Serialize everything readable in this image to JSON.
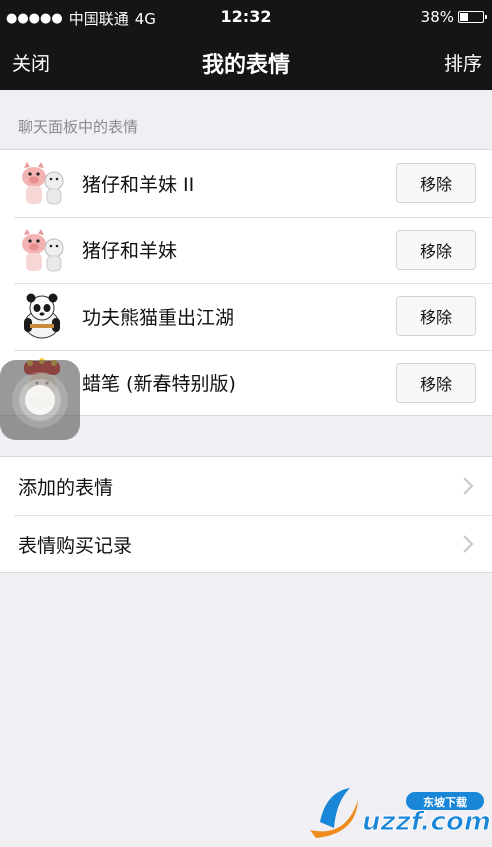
{
  "status_bar": {
    "signal_dots": "●●●●●",
    "carrier": "中国联通",
    "network": "4G",
    "time": "12:32",
    "battery_percent": "38%",
    "battery_level": 0.38
  },
  "nav": {
    "close_label": "关闭",
    "title": "我的表情",
    "sort_label": "排序"
  },
  "section_header": "聊天面板中的表情",
  "sticker_packs": [
    {
      "name": "猪仔和羊妹 II",
      "icon": "pig-and-sheep-sticker-icon",
      "action": "移除"
    },
    {
      "name": "猪仔和羊妹",
      "icon": "pig-and-sheep-sticker-icon",
      "action": "移除"
    },
    {
      "name": "功夫熊猫重出江湖",
      "icon": "kung-fu-panda-sticker-icon",
      "action": "移除"
    },
    {
      "name": "蜡笔 (新春特别版)",
      "icon": "crayon-new-year-sticker-icon",
      "action": "移除"
    }
  ],
  "menu_items": [
    {
      "label": "添加的表情",
      "icon": "chevron-right-icon"
    },
    {
      "label": "表情购买记录",
      "icon": "chevron-right-icon"
    }
  ],
  "watermark": {
    "text": "uzzf.com",
    "badge": "东坡下载"
  },
  "colors": {
    "bar_background": "#151515",
    "page_background": "#efeff4",
    "watermark_blue": "#1a86d8",
    "watermark_orange": "#f08a1c"
  }
}
